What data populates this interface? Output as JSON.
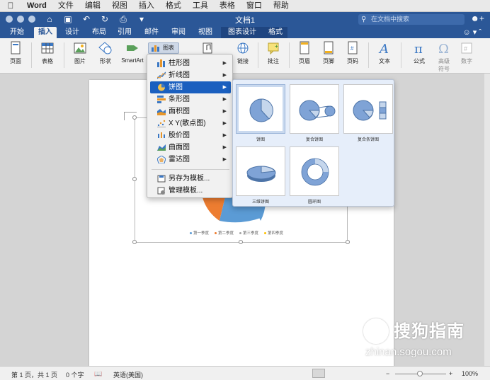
{
  "menubar": {
    "apple": "",
    "app": "Word",
    "items": [
      "文件",
      "编辑",
      "视图",
      "插入",
      "格式",
      "工具",
      "表格",
      "窗口",
      "帮助"
    ]
  },
  "window": {
    "title": "文档1",
    "search_placeholder": "在文档中搜索"
  },
  "tabs": [
    "开始",
    "插入",
    "设计",
    "布局",
    "引用",
    "邮件",
    "审阅",
    "视图",
    "图表设计",
    "格式"
  ],
  "active_tab": "插入",
  "ribbon": {
    "page": "页面",
    "table": "表格",
    "picture": "图片",
    "shapes": "形状",
    "smartart": "SmartArt",
    "chart": "图表",
    "link": "链接",
    "comment": "批注",
    "header": "页眉",
    "footer": "页脚",
    "page_number": "页码",
    "textbox": "文本",
    "equation": "公式",
    "symbol_line1": "高级",
    "symbol_line2": "符号",
    "number": "数字"
  },
  "chart_menu": {
    "items": [
      {
        "label": "柱形图",
        "has_submenu": true,
        "selected": false
      },
      {
        "label": "折线图",
        "has_submenu": true,
        "selected": false
      },
      {
        "label": "饼图",
        "has_submenu": true,
        "selected": true
      },
      {
        "label": "条形图",
        "has_submenu": true,
        "selected": false
      },
      {
        "label": "面积图",
        "has_submenu": true,
        "selected": false
      },
      {
        "label": "X Y(散点图)",
        "has_submenu": true,
        "selected": false
      },
      {
        "label": "股价图",
        "has_submenu": true,
        "selected": false
      },
      {
        "label": "曲面图",
        "has_submenu": true,
        "selected": false
      },
      {
        "label": "雷达图",
        "has_submenu": true,
        "selected": false
      }
    ],
    "save_template": "另存为模板...",
    "manage_template": "管理模板..."
  },
  "pie_flyout": {
    "thumbs": [
      {
        "label": "饼图",
        "selected": true
      },
      {
        "label": "复合饼图",
        "selected": false
      },
      {
        "label": "复合条饼图",
        "selected": false
      },
      {
        "label": "三维饼图",
        "selected": false
      },
      {
        "label": "圆环图",
        "selected": false
      }
    ]
  },
  "chart_legend": [
    "第一季度",
    "第二季度",
    "第三季度",
    "第四季度"
  ],
  "colors": {
    "ribbon_blue": "#2b5797",
    "pie_blue": "#5b9bd5",
    "pie_orange": "#ed7d31",
    "pie_gray": "#a5a5a5",
    "pie_yellow": "#ffc000",
    "select_blue": "#1a5fbf"
  },
  "status": {
    "page": "第 1 页，共 1 页",
    "words": "0 个字",
    "language": "英语(美国)",
    "zoom": "100%"
  },
  "watermark": {
    "brand": "搜狗指南",
    "url": "zhinan.sogou.com"
  }
}
